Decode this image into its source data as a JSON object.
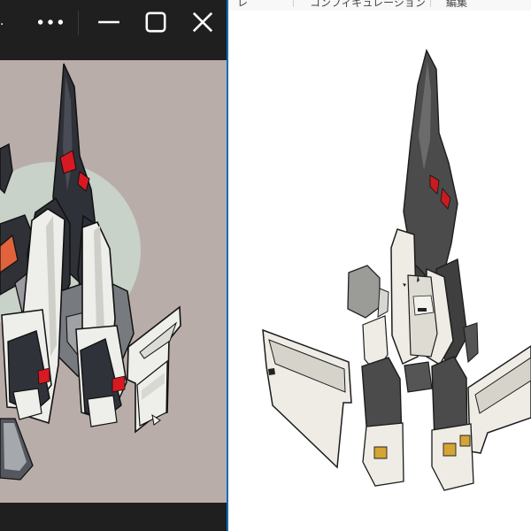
{
  "viewer": {
    "title_fragment": ".",
    "more_label": "•••",
    "minimize_icon": "minimize-icon",
    "maximize_icon": "maximize-icon",
    "close_icon": "close-icon"
  },
  "editor": {
    "toolbar_left": "レ",
    "toolbar_middle": "コンフィギュレーション",
    "toolbar_right": "編集"
  },
  "colors": {
    "accent": "#0f6cbd",
    "viewer_dark": "#1f1f1f",
    "art_background": "#b9ada9",
    "mint_circle": "#c8d2c8",
    "model_dark": "#4b4b4b",
    "model_light": "#ecebe4",
    "warning_red": "#e11b22",
    "gold_accent": "#d3a132"
  }
}
